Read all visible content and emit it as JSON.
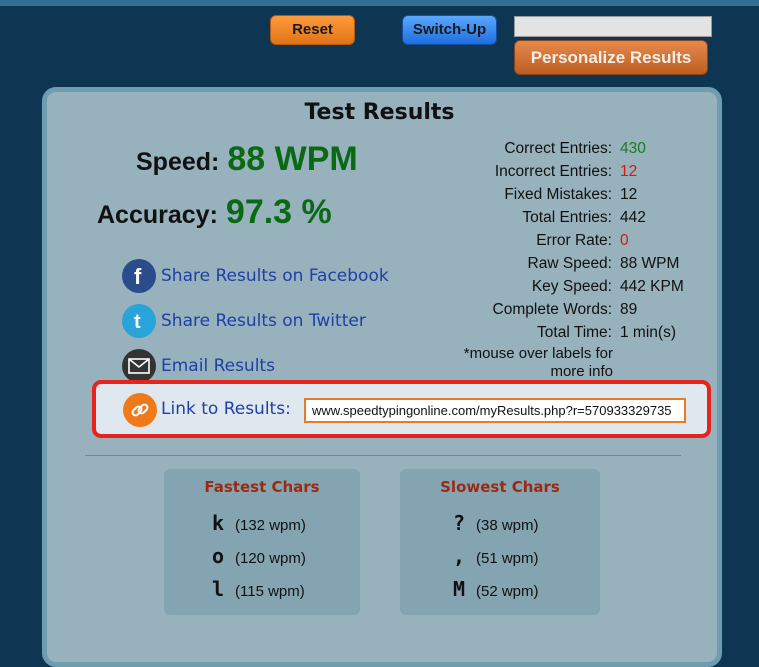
{
  "toolbar": {
    "reset_label": "Reset",
    "switchup_label": "Switch-Up",
    "personalize_label": "Personalize Results",
    "top_input_value": ""
  },
  "results": {
    "title": "Test Results",
    "speed_label": "Speed:",
    "speed_value": "88 WPM",
    "accuracy_label": "Accuracy:",
    "accuracy_value": "97.3 %"
  },
  "share": {
    "facebook": "Share Results on Facebook",
    "twitter": "Share Results on Twitter",
    "email": "Email Results"
  },
  "stats": [
    {
      "label": "Correct Entries:",
      "value": "430",
      "color": "green"
    },
    {
      "label": "Incorrect Entries:",
      "value": "12",
      "color": "red"
    },
    {
      "label": "Fixed Mistakes:",
      "value": "12",
      "color": ""
    },
    {
      "label": "Total Entries:",
      "value": "442",
      "color": ""
    },
    {
      "label": "Error Rate:",
      "value": "0",
      "color": "red"
    },
    {
      "label": "Raw Speed:",
      "value": "88 WPM",
      "color": ""
    },
    {
      "label": "Key Speed:",
      "value": "442 KPM",
      "color": ""
    },
    {
      "label": "Complete Words:",
      "value": "89",
      "color": ""
    },
    {
      "label": "Total Time:",
      "value": "1 min(s)",
      "color": ""
    }
  ],
  "note": "*mouse over labels for more info",
  "link": {
    "label": "Link to Results:",
    "value": "www.speedtypingonline.com/myResults.php?r=570933329735"
  },
  "fastest": {
    "title": "Fastest Chars",
    "items": [
      {
        "char": "k",
        "wpm": "(132 wpm)"
      },
      {
        "char": "o",
        "wpm": "(120 wpm)"
      },
      {
        "char": "l",
        "wpm": "(115 wpm)"
      }
    ]
  },
  "slowest": {
    "title": "Slowest Chars",
    "items": [
      {
        "char": "?",
        "wpm": "(38 wpm)"
      },
      {
        "char": ",",
        "wpm": "(51 wpm)"
      },
      {
        "char": "M",
        "wpm": "(52 wpm)"
      }
    ]
  },
  "icons": {
    "facebook": "facebook-icon",
    "twitter": "twitter-icon",
    "email": "email-icon",
    "link": "link-icon"
  },
  "colors": {
    "background": "#0e3552",
    "panel": "#97b1bd",
    "speed_green": "#0a6a14",
    "highlight_red": "#e8231b",
    "link_blue": "#1f3fa6"
  }
}
